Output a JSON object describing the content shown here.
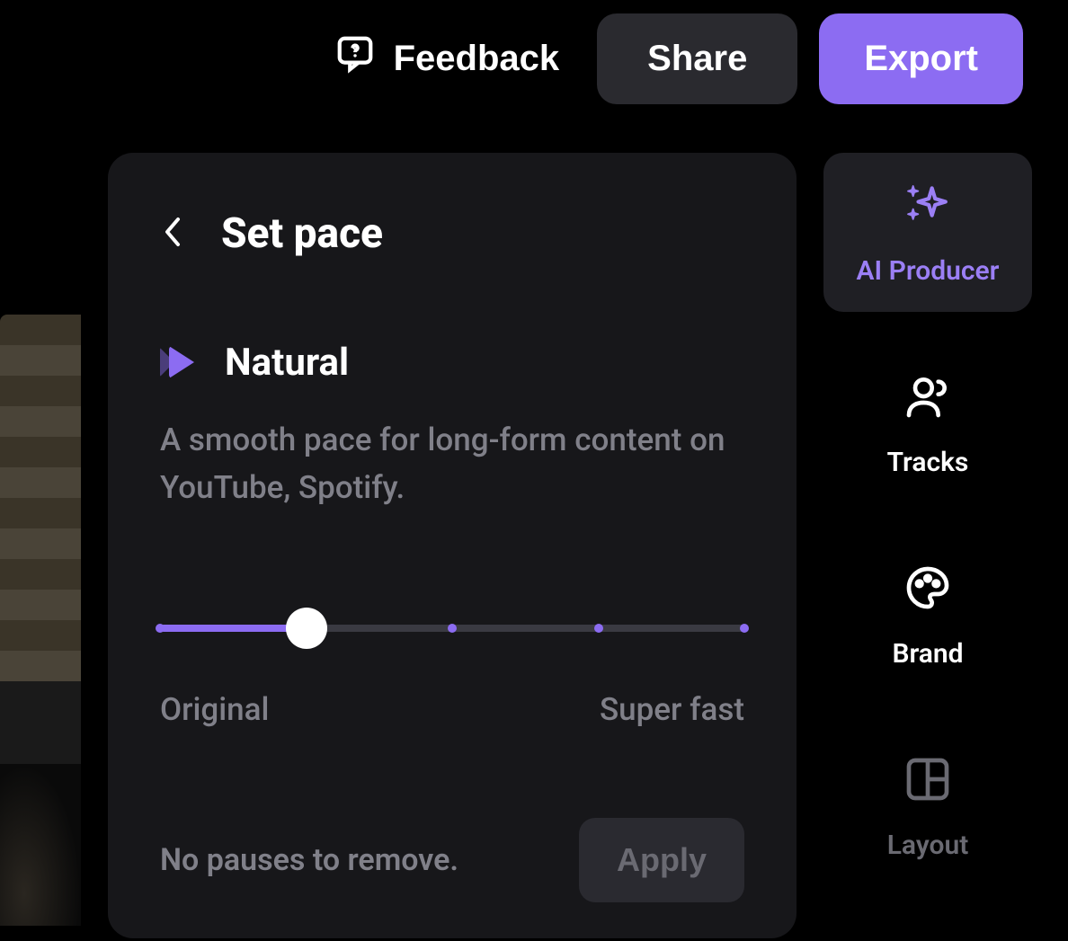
{
  "header": {
    "feedback_label": "Feedback",
    "share_label": "Share",
    "export_label": "Export"
  },
  "panel": {
    "title": "Set pace",
    "pace": {
      "name": "Natural",
      "description": "A smooth pace for long-form content on YouTube, Spotify.",
      "slider": {
        "min_label": "Original",
        "max_label": "Super fast",
        "value_index": 1,
        "total_stops": 5
      },
      "status": "No pauses to remove.",
      "apply_label": "Apply"
    }
  },
  "sidebar": {
    "items": [
      {
        "label": "AI Producer",
        "icon": "sparkle",
        "active": true
      },
      {
        "label": "Tracks",
        "icon": "users",
        "active": false
      },
      {
        "label": "Brand",
        "icon": "palette",
        "active": false
      },
      {
        "label": "Layout",
        "icon": "layout",
        "active": false,
        "dimmed": true
      }
    ]
  },
  "colors": {
    "accent": "#8c6cf2",
    "bg": "#000000",
    "panel": "#17171a",
    "text_muted": "#808089"
  }
}
